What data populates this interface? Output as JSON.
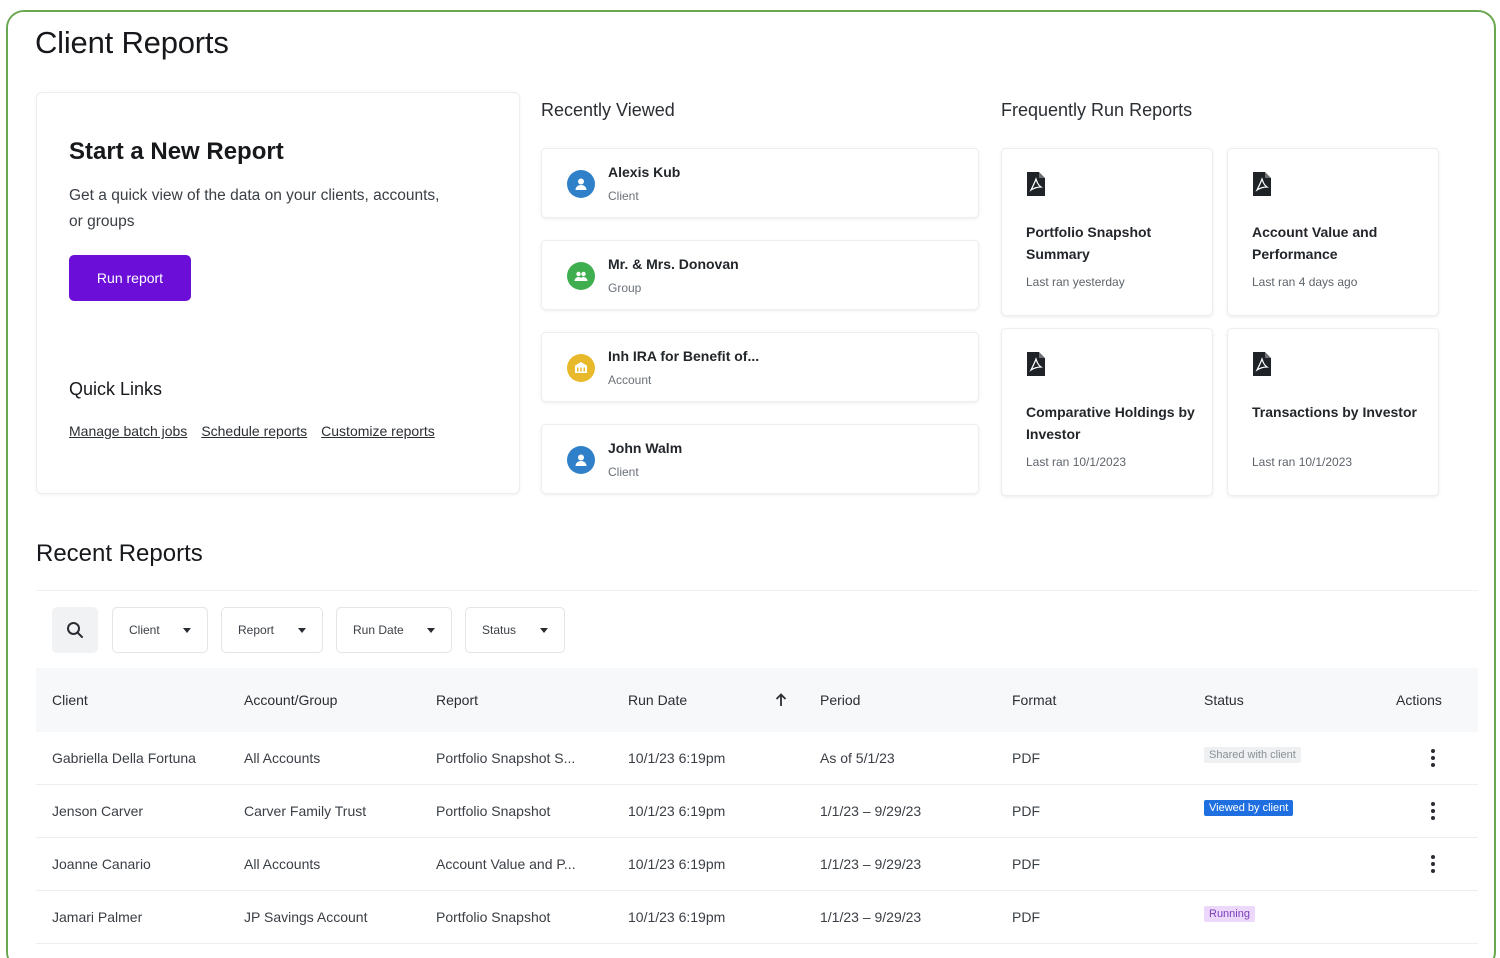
{
  "page": {
    "title": "Client Reports"
  },
  "start": {
    "title": "Start a New Report",
    "description": "Get a quick view of the data on your clients, accounts, or groups",
    "run_button": "Run report",
    "quick_links_title": "Quick Links",
    "quick_links": [
      "Manage batch jobs",
      "Schedule reports",
      "Customize reports"
    ]
  },
  "recently_viewed": {
    "title": "Recently Viewed",
    "items": [
      {
        "name": "Alexis Kub",
        "type": "Client",
        "icon": "person-icon",
        "color": "#2f80c8"
      },
      {
        "name": "Mr. & Mrs. Donovan",
        "type": "Group",
        "icon": "group-icon",
        "color": "#3fae4f"
      },
      {
        "name": "Inh IRA for Benefit of...",
        "type": "Account",
        "icon": "account-icon",
        "color": "#e8b92a"
      },
      {
        "name": "John Walm",
        "type": "Client",
        "icon": "person-icon",
        "color": "#2f80c8"
      }
    ]
  },
  "frequent": {
    "title": "Frequently Run Reports",
    "items": [
      {
        "name": "Portfolio Snapshot Summary",
        "last_run": "Last ran yesterday"
      },
      {
        "name": "Account Value and Performance",
        "last_run": "Last ran 4 days ago"
      },
      {
        "name": "Comparative Holdings by Investor",
        "last_run": "Last ran 10/1/2023"
      },
      {
        "name": "Transactions by Investor",
        "last_run": "Last ran 10/1/2023"
      }
    ]
  },
  "recent": {
    "title": "Recent Reports",
    "filters": [
      "Client",
      "Report",
      "Run Date",
      "Status"
    ],
    "columns": [
      "Client",
      "Account/Group",
      "Report",
      "Run Date",
      "Period",
      "Format",
      "Status",
      "Actions"
    ],
    "rows": [
      {
        "client": "Gabriella Della Fortuna",
        "account": "All Accounts",
        "report": "Portfolio Snapshot S...",
        "run_date": "10/1/23 6:19pm",
        "period": "As of 5/1/23",
        "format": "PDF",
        "status": "Shared with client",
        "status_kind": "shared",
        "has_actions": true
      },
      {
        "client": "Jenson Carver",
        "account": "Carver Family Trust",
        "report": "Portfolio Snapshot",
        "run_date": "10/1/23 6:19pm",
        "period": "1/1/23 – 9/29/23",
        "format": "PDF",
        "status": "Viewed by client",
        "status_kind": "viewed",
        "has_actions": true
      },
      {
        "client": "Joanne Canario",
        "account": "All Accounts",
        "report": "Account Value and P...",
        "run_date": "10/1/23 6:19pm",
        "period": "1/1/23 – 9/29/23",
        "format": "PDF",
        "status": "",
        "status_kind": "none",
        "has_actions": true
      },
      {
        "client": "Jamari Palmer",
        "account": "JP Savings Account",
        "report": "Portfolio Snapshot",
        "run_date": "10/1/23 6:19pm",
        "period": "1/1/23 – 9/29/23",
        "format": "PDF",
        "status": "Running",
        "status_kind": "running",
        "has_actions": false
      }
    ],
    "badge_colors": {
      "shared": {
        "bg": "#eef0f2",
        "fg": "#8a9096"
      },
      "viewed": {
        "bg": "#1f6fe0",
        "fg": "#ffffff"
      },
      "running": {
        "bg": "#ecd8fb",
        "fg": "#7a3fb8"
      }
    }
  }
}
